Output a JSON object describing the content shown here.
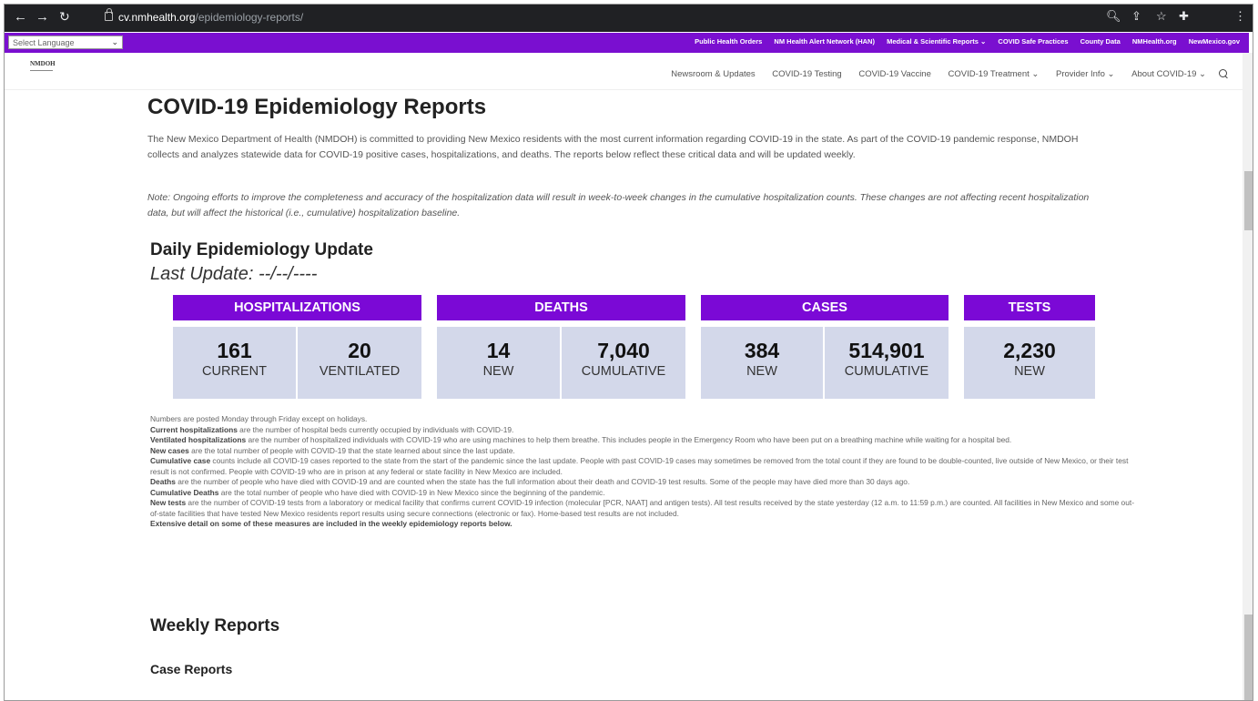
{
  "browser": {
    "url_host": "cv.nmhealth.org",
    "url_path": "/epidemiology-reports/"
  },
  "topbar": {
    "language_select": "Select Language",
    "links": [
      "Public Health Orders",
      "NM Health Alert Network (HAN)",
      "Medical & Scientific Reports ⌄",
      "COVID Safe Practices",
      "County Data",
      "NMHealth.org",
      "NewMexico.gov"
    ]
  },
  "site": {
    "logo": "NMDOH",
    "nav": [
      "Newsroom & Updates",
      "COVID-19 Testing",
      "COVID-19 Vaccine",
      "COVID-19 Treatment ⌄",
      "Provider Info ⌄",
      "About COVID-19 ⌄"
    ]
  },
  "page": {
    "title": "COVID-19 Epidemiology Reports",
    "intro": "The New Mexico Department of Health (NMDOH) is committed to providing New Mexico residents with the most current information regarding COVID-19 in the state. As part of the COVID-19 pandemic response, NMDOH collects and analyzes statewide data for COVID-19 positive cases, hospitalizations, and deaths. The reports below reflect these critical data and will be updated weekly.",
    "note": "Note: Ongoing efforts to improve the completeness and accuracy of the hospitalization data will result in week-to-week changes in the cumulative hospitalization counts. These changes are not affecting recent hospitalization data, but will affect the historical (i.e., cumulative) hospitalization baseline."
  },
  "daily": {
    "title": "Daily Epidemiology Update",
    "last_update": "Last Update: --/--/----",
    "hospitalizations": {
      "header": "HOSPITALIZATIONS",
      "current": "161",
      "current_label": "CURRENT",
      "ventilated": "20",
      "ventilated_label": "VENTILATED"
    },
    "deaths": {
      "header": "DEATHS",
      "new": "14",
      "new_label": "NEW",
      "cumulative": "7,040",
      "cumulative_label": "CUMULATIVE"
    },
    "cases": {
      "header": "CASES",
      "new": "384",
      "new_label": "NEW",
      "cumulative": "514,901",
      "cumulative_label": "CUMULATIVE"
    },
    "tests": {
      "header": "TESTS",
      "new": "2,230",
      "new_label": "NEW"
    }
  },
  "definitions": {
    "posted": "Numbers are posted Monday through Friday except on holidays.",
    "current_term": "Current hospitalizations",
    "current_text": " are the number of hospital beds currently occupied by individuals with COVID-19.",
    "ventilated_term": "Ventilated hospitalizations",
    "ventilated_text": " are the number of hospitalized individuals with COVID-19 who are using machines to help them breathe. This includes people in the Emergency Room who have been put on a breathing machine while waiting for a hospital bed.",
    "newcases_term": "New cases",
    "newcases_text": " are the total number of people with COVID-19 that the state learned about since the last update.",
    "cumcase_term": "Cumulative case",
    "cumcase_text": " counts include all COVID-19 cases reported to the state from the start of the pandemic since the last update. People with past COVID-19 cases may sometimes be removed from the total count if they are found to be double-counted, live outside of New Mexico, or their test result is not confirmed. People with COVID-19 who are in prison at any federal or state facility in New Mexico are included.",
    "deaths_term": "Deaths",
    "deaths_text": " are the number of people who have died with COVID-19 and are counted when the state has the full information about their death and COVID-19 test results. Some of the people may have died more than 30 days ago.",
    "cumdeaths_term": "Cumulative Deaths",
    "cumdeaths_text": " are the total number of people who have died with COVID-19 in New Mexico since the beginning of the pandemic.",
    "newtests_term": "New tests",
    "newtests_text": " are the number of COVID-19 tests from a laboratory or medical facility that confirms current COVID-19 infection (molecular [PCR, NAAT] and antigen tests). All test results received by the state yesterday (12 a.m. to 11:59 p.m.) are counted. All facilities in New Mexico and some out-of-state facilities that have tested New Mexico residents report results using secure connections (electronic or fax). Home-based test results are not included.",
    "extensive": "Extensive detail on some of these measures are included in the weekly epidemiology reports below."
  },
  "weekly": {
    "title": "Weekly Reports",
    "case_reports": "Case Reports"
  },
  "colors": {
    "accent_purple": "#7b09d6",
    "stat_bg": "#d3d8ea",
    "red": "#c62828"
  }
}
